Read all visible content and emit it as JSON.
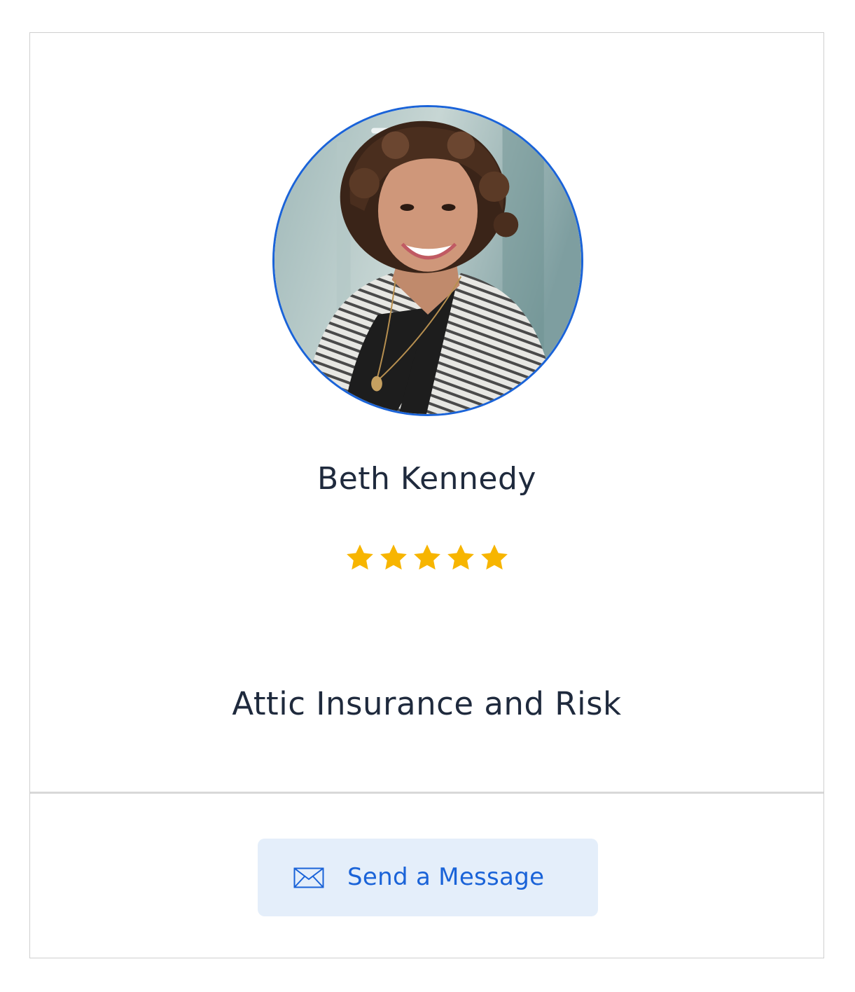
{
  "profile": {
    "name": "Beth Kennedy",
    "company": "Attic Insurance and Risk",
    "rating": {
      "stars": 5,
      "max": 5,
      "color": "#f7b500"
    }
  },
  "contact": {
    "send_label": "Send a Message",
    "icon": "mail-icon",
    "accent": "#1a63d8"
  }
}
